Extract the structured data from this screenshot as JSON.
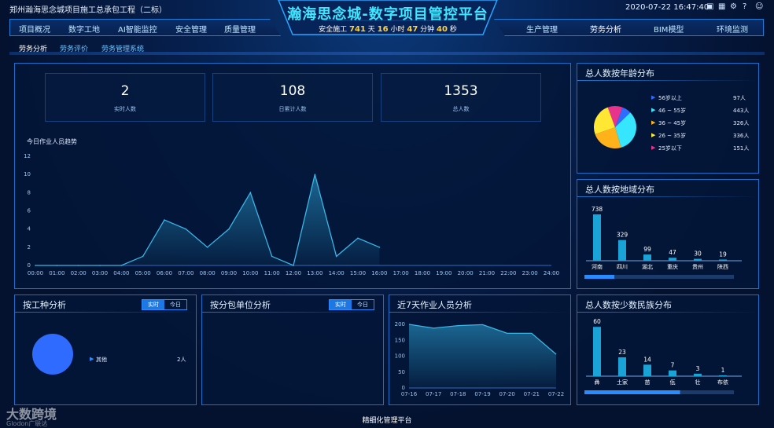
{
  "header": {
    "project": "郑州瀚海思念城项目施工总承包工程（二标）",
    "title": "瀚海思念城-数字项目管控平台",
    "datetime": "2020-07-22 16:47:40",
    "safe_prefix": "安全施工",
    "safe_days": "741",
    "safe_day_unit": "天",
    "safe_hours": "16",
    "safe_hour_unit": "小时",
    "safe_minutes": "47",
    "safe_minute_unit": "分钟",
    "safe_seconds": "40",
    "safe_second_unit": "秒"
  },
  "nav_left": [
    "项目概况",
    "数字工地",
    "AI智能监控",
    "安全管理",
    "质量管理"
  ],
  "nav_right": [
    "生产管理",
    "劳务分析",
    "BIM模型",
    "环境监测"
  ],
  "subnav": [
    "劳务分析",
    "劳务评价",
    "劳务管理系统"
  ],
  "stats": [
    {
      "value": "2",
      "label": "实时人数"
    },
    {
      "value": "108",
      "label": "日累计人数"
    },
    {
      "value": "1353",
      "label": "总人数"
    }
  ],
  "trend": {
    "title": "今日作业人员趋势"
  },
  "age": {
    "title": "总人数按年龄分布"
  },
  "region": {
    "title": "总人数按地域分布"
  },
  "trade": {
    "title": "按工种分析",
    "btn_realtime": "实时",
    "btn_today": "今日",
    "legend_label": "其他",
    "legend_value": "2人"
  },
  "subunit": {
    "title": "按分包单位分析",
    "btn_realtime": "实时",
    "btn_today": "今日"
  },
  "week": {
    "title": "近7天作业人员分析"
  },
  "ethnic": {
    "title": "总人数按少数民族分布"
  },
  "footer": "精细化管理平台",
  "watermark": {
    "brand": "大数跨境",
    "sub": "Glodon广联达"
  },
  "colors": {
    "accent": "#3ee6ff",
    "bar": "#1aa3d6",
    "highlight": "#ffd23a"
  },
  "chart_data": [
    {
      "type": "area",
      "title": "今日作业人员趋势",
      "x": [
        "00:00",
        "01:00",
        "02:00",
        "03:00",
        "04:00",
        "05:00",
        "06:00",
        "07:00",
        "08:00",
        "09:00",
        "10:00",
        "11:00",
        "12:00",
        "13:00",
        "14:00",
        "15:00",
        "16:00",
        "17:00",
        "18:00",
        "19:00",
        "20:00",
        "21:00",
        "22:00",
        "23:00",
        "24:00"
      ],
      "values": [
        0,
        0,
        0,
        0,
        0,
        1,
        5,
        4,
        2,
        4,
        8,
        1,
        0,
        10,
        1,
        3,
        2
      ],
      "ylim": [
        0,
        12
      ],
      "yticks": [
        0,
        2,
        4,
        6,
        8,
        10,
        12
      ]
    },
    {
      "type": "pie",
      "title": "总人数按年龄分布",
      "categories": [
        "56岁以上",
        "46 ~ 55岁",
        "36 ~ 45岁",
        "26 ~ 35岁",
        "25岁以下"
      ],
      "labels": [
        "97人",
        "443人",
        "326人",
        "336人",
        "151人"
      ],
      "values": [
        97,
        443,
        326,
        336,
        151
      ],
      "colors": [
        "#2f6bff",
        "#36e6ff",
        "#ffb21a",
        "#ffe733",
        "#e8338d"
      ]
    },
    {
      "type": "bar",
      "title": "总人数按地域分布",
      "categories": [
        "河南",
        "四川",
        "湖北",
        "重庆",
        "贵州",
        "陕西"
      ],
      "values": [
        738,
        329,
        99,
        47,
        30,
        19
      ],
      "ylim": [
        0,
        800
      ],
      "scroll_fraction": 0.2
    },
    {
      "type": "pie",
      "title": "按工种分析",
      "categories": [
        "其他"
      ],
      "values": [
        2
      ],
      "colors": [
        "#2f6bff"
      ]
    },
    {
      "type": "area",
      "title": "近7天作业人员分析",
      "x": [
        "07-16",
        "07-17",
        "07-18",
        "07-19",
        "07-20",
        "07-21",
        "07-22"
      ],
      "values": [
        200,
        188,
        196,
        199,
        172,
        172,
        106
      ],
      "ylim": [
        0,
        200
      ],
      "yticks": [
        0,
        50,
        100,
        150,
        200
      ]
    },
    {
      "type": "bar",
      "title": "总人数按少数民族分布",
      "categories": [
        "彝",
        "土家",
        "苗",
        "佤",
        "壮",
        "布依"
      ],
      "values": [
        60,
        23,
        14,
        7,
        3,
        1
      ],
      "ylim": [
        0,
        65
      ],
      "scroll_fraction": 0.64
    }
  ]
}
